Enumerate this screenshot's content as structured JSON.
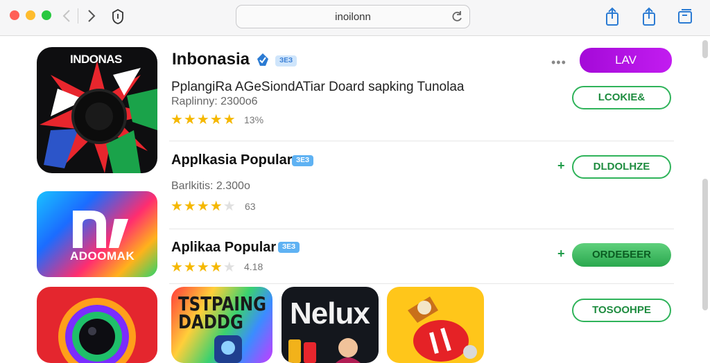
{
  "toolbar": {
    "url": "inoilonn"
  },
  "apps": [
    {
      "icon_text": "INDONAS",
      "title": "Inbonasia",
      "badge": "ЗЕЗ",
      "subtitle": "PplangiRa AGeSiondATiar Doard sapking Tunolaa",
      "meta": "Raplinny: 2300o6",
      "rating": 5,
      "score": "13%",
      "primary_button": "LAV",
      "secondary_button": "LCOKIE&"
    },
    {
      "icon_text": "ADOOMAK",
      "title": "Applkasia Popular",
      "badge": "ЗЕЗ",
      "meta": "Barlkitis: 2.300o",
      "rating": 4.5,
      "score": "63",
      "button": "DLDOLHZE"
    },
    {
      "title": "Aplikaa Popular",
      "badge": "ЗЕЗ",
      "rating": 4,
      "score": "4.18",
      "button": "ORDEБEER"
    }
  ],
  "bottom_row": {
    "icon4_text": "TSTPAING\nDADDG",
    "icon5_text": "Nelux",
    "button": "TOSOOHPE"
  }
}
